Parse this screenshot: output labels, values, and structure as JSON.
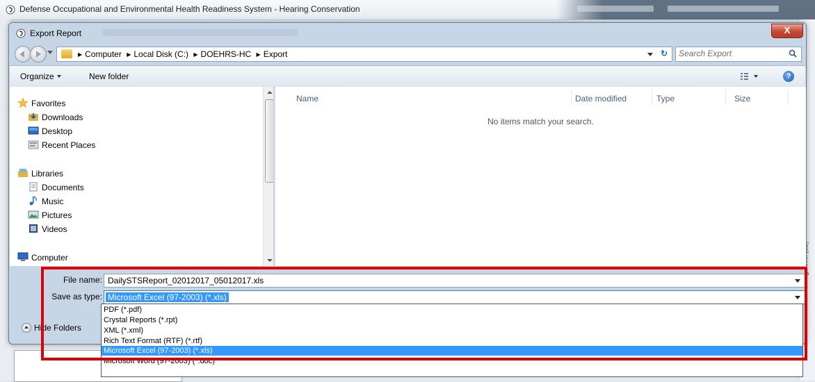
{
  "app": {
    "title": "Defense Occupational and Environmental Health Readiness System - Hearing Conservation",
    "side_label": "Hearing Level (dB)"
  },
  "dialog": {
    "title": "Export Report",
    "close_label": "X",
    "breadcrumb": [
      {
        "label": "Computer"
      },
      {
        "label": "Local Disk (C:)"
      },
      {
        "label": "DOEHRS-HC"
      },
      {
        "label": "Export"
      }
    ],
    "search_placeholder": "Search Export",
    "toolbar": {
      "organize_label": "Organize",
      "new_folder_label": "New folder",
      "help_label": "?"
    },
    "nav": {
      "favorites_label": "Favorites",
      "favorites": [
        {
          "label": "Downloads"
        },
        {
          "label": "Desktop"
        },
        {
          "label": "Recent Places"
        }
      ],
      "libraries_label": "Libraries",
      "libraries": [
        {
          "label": "Documents"
        },
        {
          "label": "Music"
        },
        {
          "label": "Pictures"
        },
        {
          "label": "Videos"
        }
      ],
      "computer_label": "Computer"
    },
    "columns": [
      "Name",
      "Date modified",
      "Type",
      "Size"
    ],
    "empty_message": "No items match your search.",
    "form": {
      "file_name_label": "File name:",
      "file_name_value": "DailySTSReport_02012017_05012017.xls",
      "save_as_type_label": "Save as type:",
      "save_as_type_value": "Microsoft Excel (97-2003) (*.xls)",
      "hide_folders_label": "Hide Folders"
    },
    "type_options": [
      "PDF (*.pdf)",
      "Crystal Reports (*.rpt)",
      "XML (*.xml)",
      "Rich Text Format (RTF) (*.rtf)",
      "Microsoft Excel (97-2003) (*.xls)",
      "Microsoft Word (97-2003) (*.doc)"
    ],
    "selected_type_index": 4
  },
  "colors": {
    "dialog_frame": "#c7d6e6",
    "selection": "#3399ff",
    "annotation": "#e00000",
    "close_button": "#c44a36"
  }
}
